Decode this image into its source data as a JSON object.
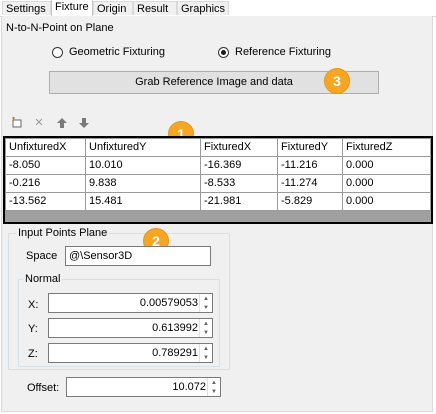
{
  "tabs": [
    "Settings",
    "Fixture",
    "Origin",
    "Result",
    "Graphics"
  ],
  "active_tab": "Fixture",
  "section_title": "N-to-N-Point on Plane",
  "radio": {
    "geometric": "Geometric Fixturing",
    "reference": "Reference Fixturing",
    "selected": "Reference Fixturing"
  },
  "grab_button": "Grab Reference Image and data",
  "badges": {
    "b1": "1",
    "b2": "2",
    "b3": "3"
  },
  "toolbar": {
    "new_icon": "new-row-icon",
    "delete_icon": "delete-icon",
    "up_icon": "move-up-icon",
    "down_icon": "move-down-icon"
  },
  "table": {
    "columns": [
      "UnfixturedX",
      "UnfixturedY",
      "FixturedX",
      "FixturedY",
      "FixturedZ"
    ],
    "rows": [
      [
        "-8.050",
        "10.010",
        "-16.369",
        "-11.216",
        "0.000"
      ],
      [
        "-0.216",
        "9.838",
        "-8.533",
        "-11.274",
        "0.000"
      ],
      [
        "-13.562",
        "15.481",
        "-21.981",
        "-5.829",
        "0.000"
      ]
    ]
  },
  "input_plane": {
    "title": "Input Points Plane",
    "space_label": "Space",
    "space_value": "@\\Sensor3D",
    "normal_title": "Normal",
    "x_label": "X:",
    "x_value": "0.00579053",
    "y_label": "Y:",
    "y_value": "0.613992",
    "z_label": "Z:",
    "z_value": "0.789291"
  },
  "offset": {
    "label": "Offset:",
    "value": "10.072"
  },
  "colors": {
    "badge": "#f5a623",
    "panel": "#f0f0f0"
  }
}
